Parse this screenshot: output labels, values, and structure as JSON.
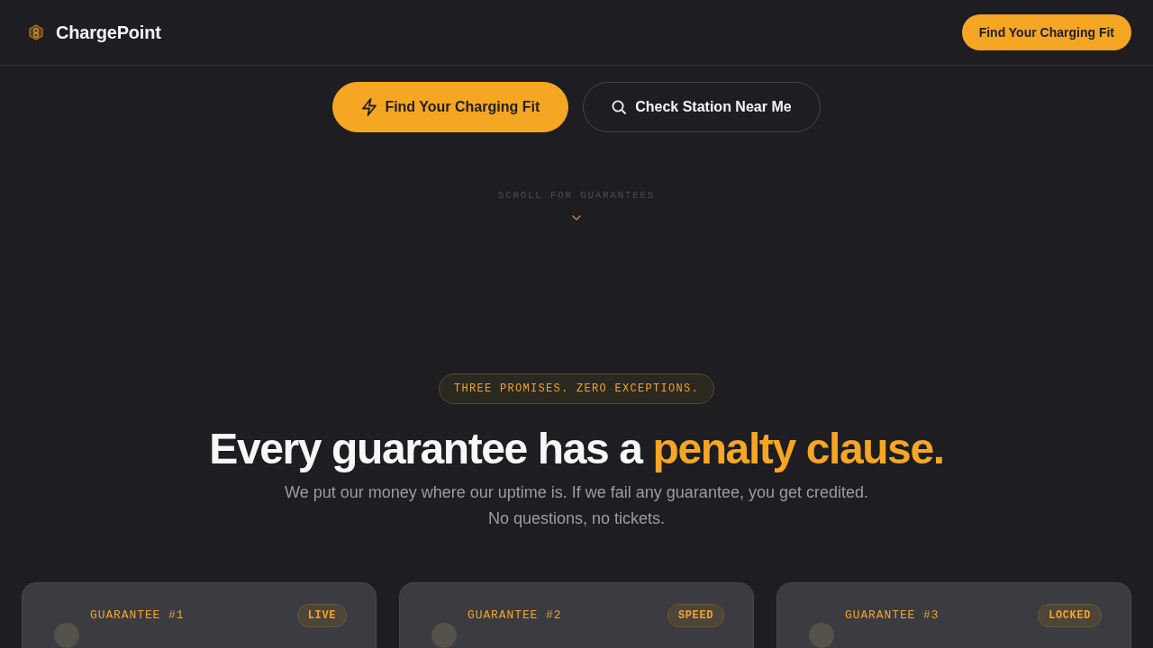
{
  "header": {
    "brand": "ChargePoint",
    "cta": "Find Your Charging Fit"
  },
  "hero": {
    "buttons": [
      {
        "label": "Find Your Charging Fit",
        "kind": "primary"
      },
      {
        "label": "Check Station Near Me",
        "kind": "secondary"
      }
    ],
    "scroll_hint": "SCROLL FOR GUARANTEES"
  },
  "guarantees": {
    "eyebrow": "THREE PROMISES. ZERO EXCEPTIONS.",
    "heading": "Every guarantee has a",
    "heading_highlight": "penalty clause.",
    "subtitle": "We put our money where our uptime is. If we fail any guarantee, you get credited. No questions, no tickets.",
    "cards": [
      {
        "label": "GUARANTEE #1",
        "badge": "LIVE"
      },
      {
        "label": "GUARANTEE #2",
        "badge": "SPEED"
      },
      {
        "label": "GUARANTEE #3",
        "badge": "LOCKED"
      }
    ]
  }
}
